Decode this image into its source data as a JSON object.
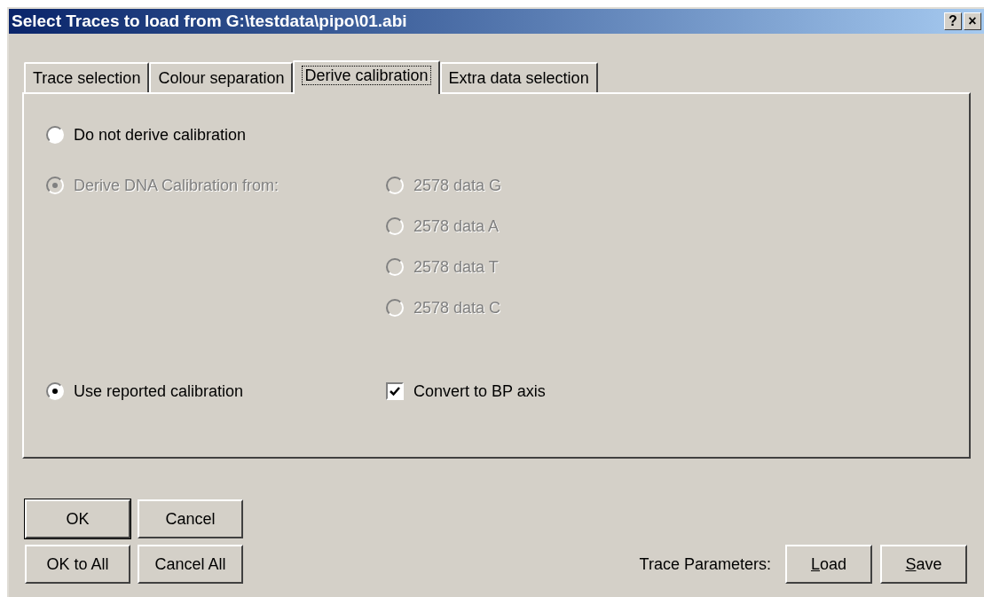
{
  "window": {
    "title": "Select Traces to load from G:\\testdata\\pipo\\01.abi",
    "title_buttons": [
      "?",
      "×"
    ]
  },
  "tabs": [
    {
      "label": "Trace selection",
      "selected": false
    },
    {
      "label": "Colour separation",
      "selected": false
    },
    {
      "label": "Derive calibration",
      "selected": true
    },
    {
      "label": "Extra data selection",
      "selected": false
    }
  ],
  "calibration": {
    "do_not": {
      "label": "Do not derive calibration",
      "selected": false,
      "disabled": false
    },
    "derive": {
      "label": "Derive DNA Calibration from:",
      "selected": true,
      "disabled": true
    },
    "sources": [
      {
        "label": "2578 data G",
        "selected": false,
        "disabled": true
      },
      {
        "label": "2578 data A",
        "selected": false,
        "disabled": true
      },
      {
        "label": "2578 data T",
        "selected": false,
        "disabled": true
      },
      {
        "label": "2578 data C",
        "selected": false,
        "disabled": true
      }
    ],
    "reported": {
      "label": "Use reported calibration",
      "selected": true,
      "disabled": false
    },
    "convert": {
      "label": "Convert to BP axis",
      "checked": true
    }
  },
  "buttons": [
    {
      "label": "OK",
      "default": true
    },
    {
      "label": "Cancel",
      "default": false
    },
    {
      "label": "OK to All",
      "default": false
    },
    {
      "label": "Cancel All",
      "default": false
    }
  ],
  "trace_parameters": {
    "label": "Trace Parameters:",
    "buttons": [
      {
        "label": "Load",
        "mnemonic": true
      },
      {
        "label": "Save",
        "mnemonic": true
      }
    ]
  }
}
